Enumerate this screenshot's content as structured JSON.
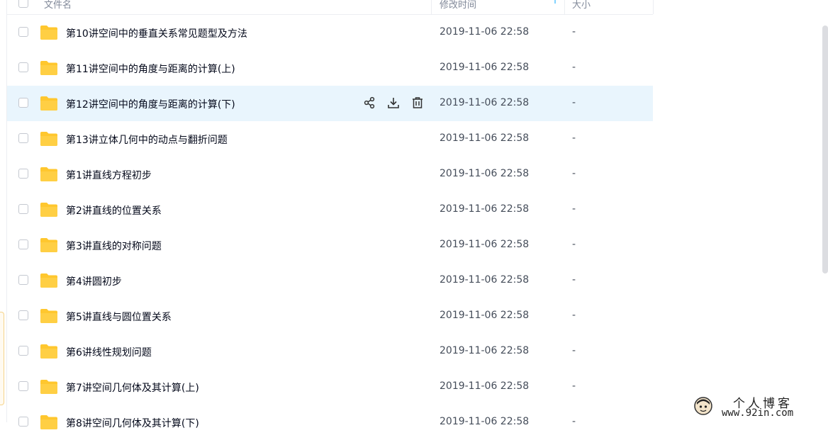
{
  "header": {
    "name_label": "文件名",
    "time_label": "修改时间",
    "size_label": "大小"
  },
  "rows": [
    {
      "name": "第10讲空间中的垂直关系常见题型及方法",
      "time": "2019-11-06 22:58",
      "size": "-"
    },
    {
      "name": "第11讲空间中的角度与距离的计算(上)",
      "time": "2019-11-06 22:58",
      "size": "-"
    },
    {
      "name": "第12讲空间中的角度与距离的计算(下)",
      "time": "2019-11-06 22:58",
      "size": "-"
    },
    {
      "name": "第13讲立体几何中的动点与翻折问题",
      "time": "2019-11-06 22:58",
      "size": "-"
    },
    {
      "name": "第1讲直线方程初步",
      "time": "2019-11-06 22:58",
      "size": "-"
    },
    {
      "name": "第2讲直线的位置关系",
      "time": "2019-11-06 22:58",
      "size": "-"
    },
    {
      "name": "第3讲直线的对称问题",
      "time": "2019-11-06 22:58",
      "size": "-"
    },
    {
      "name": "第4讲圆初步",
      "time": "2019-11-06 22:58",
      "size": "-"
    },
    {
      "name": "第5讲直线与圆位置关系",
      "time": "2019-11-06 22:58",
      "size": "-"
    },
    {
      "name": "第6讲线性规划问题",
      "time": "2019-11-06 22:58",
      "size": "-"
    },
    {
      "name": "第7讲空间几何体及其计算(上)",
      "time": "2019-11-06 22:58",
      "size": "-"
    },
    {
      "name": "第8讲空间几何体及其计算(下)",
      "time": "2019-11-06 22:58",
      "size": "-"
    }
  ],
  "hover_row_index": 2,
  "row_actions": [
    "share-icon",
    "download-icon",
    "delete-icon"
  ],
  "watermark": {
    "title": "个人博客",
    "url": "www.92in.com"
  },
  "colors": {
    "folder": "#ffc72e",
    "hover_bg": "#e9f5fd",
    "accent": "#06a7ff"
  }
}
